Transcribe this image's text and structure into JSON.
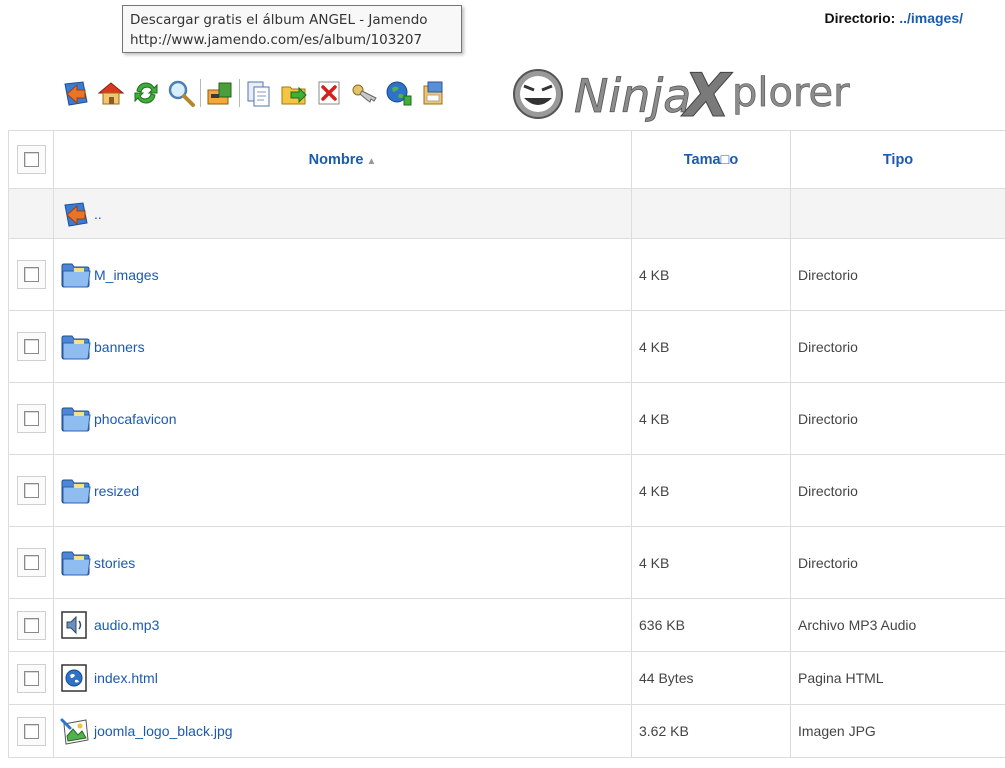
{
  "tooltip": {
    "line1": "Descargar gratis el álbum ANGEL - Jamendo",
    "line2": "http://www.jamendo.com/es/album/103207"
  },
  "directory": {
    "label": "Directorio:",
    "path": "../images/"
  },
  "logo": {
    "text_part1": "Ninja",
    "text_part2": "X",
    "text_part3": "plorer"
  },
  "toolbar": {
    "buttons": [
      {
        "icon": "back-arrow-icon"
      },
      {
        "icon": "home-icon"
      },
      {
        "icon": "refresh-icon"
      },
      {
        "icon": "search-icon"
      },
      {
        "icon": "archive-icon"
      },
      {
        "icon": "copy-icon"
      },
      {
        "icon": "move-icon"
      },
      {
        "icon": "delete-icon"
      },
      {
        "icon": "rename-icon"
      },
      {
        "icon": "upload-icon"
      },
      {
        "icon": "new-item-icon"
      }
    ]
  },
  "table": {
    "headers": {
      "name": "Nombre",
      "size": "Tama□o",
      "type": "Tipo"
    },
    "parent_label": "..",
    "rows": [
      {
        "name": "M_images",
        "size": "4 KB",
        "type": "Directorio",
        "kind": "folder"
      },
      {
        "name": "banners",
        "size": "4 KB",
        "type": "Directorio",
        "kind": "folder"
      },
      {
        "name": "phocafavicon",
        "size": "4 KB",
        "type": "Directorio",
        "kind": "folder"
      },
      {
        "name": "resized",
        "size": "4 KB",
        "type": "Directorio",
        "kind": "folder"
      },
      {
        "name": "stories",
        "size": "4 KB",
        "type": "Directorio",
        "kind": "folder"
      },
      {
        "name": "audio.mp3",
        "size": "636 KB",
        "type": "Archivo MP3 Audio",
        "kind": "audio"
      },
      {
        "name": "index.html",
        "size": "44 Bytes",
        "type": "Pagina HTML",
        "kind": "html"
      },
      {
        "name": "joomla_logo_black.jpg",
        "size": "3.62 KB",
        "type": "Imagen JPG",
        "kind": "image"
      }
    ]
  },
  "colors": {
    "link": "#1a5bb0",
    "border": "#dcdcdc",
    "parent_row_bg": "#f4f4f4"
  }
}
